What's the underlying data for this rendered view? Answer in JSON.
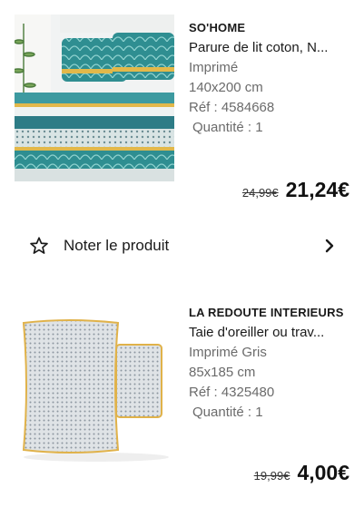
{
  "products": [
    {
      "brand": "SO'HOME",
      "title": "Parure de lit coton, N...",
      "color": "Imprimé",
      "size": "140x200 cm",
      "ref": "Réf : 4584668",
      "quantity": "Quantité : 1",
      "old_price": "24,99€",
      "new_price": "21,24€"
    },
    {
      "brand": "LA REDOUTE INTERIEURS",
      "title": "Taie d'oreiller ou trav...",
      "color": "Imprimé Gris",
      "size": "85x185 cm",
      "ref": "Réf : 4325480",
      "quantity": "Quantité : 1",
      "old_price": "19,99€",
      "new_price": "4,00€"
    }
  ],
  "rate_product": {
    "label": "Noter le produit",
    "icon": "star-outline-icon"
  },
  "colors": {
    "text": "#1a1a1a",
    "secondary_text": "#6b6b6b"
  }
}
